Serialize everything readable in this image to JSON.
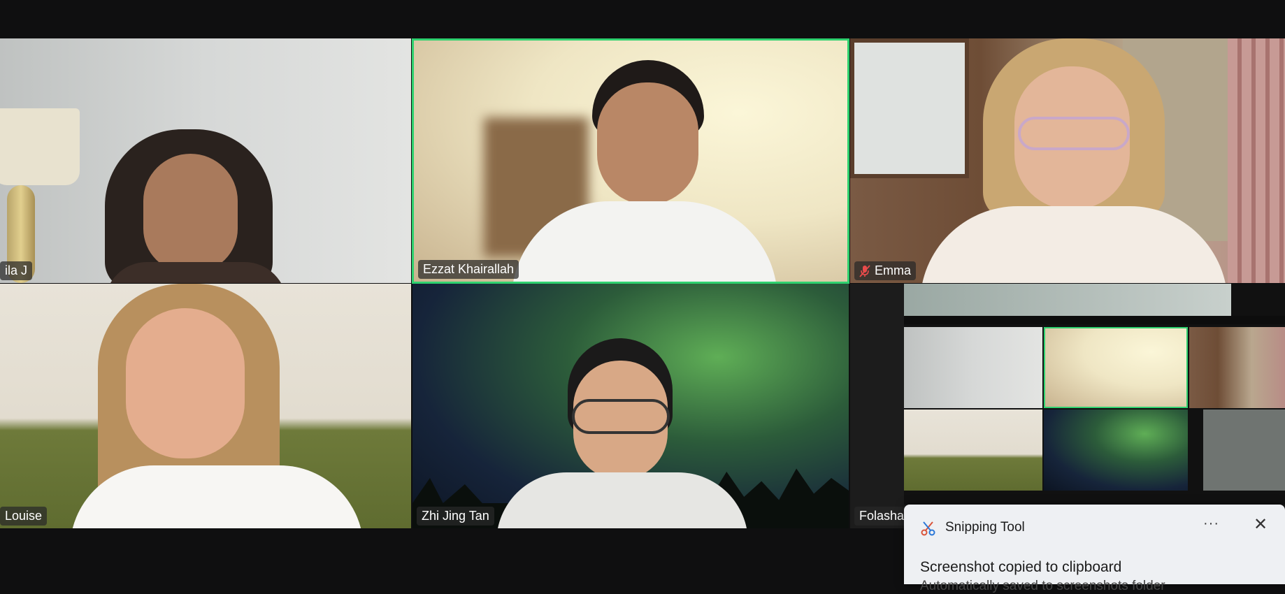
{
  "participants": [
    {
      "name": "ila J",
      "muted": false
    },
    {
      "name": "Ezzat Khairallah",
      "muted": false,
      "active": true
    },
    {
      "name": "Emma",
      "muted": true
    },
    {
      "name": "Louise",
      "muted": false
    },
    {
      "name": "Zhi Jing Tan",
      "muted": false
    },
    {
      "name": "Folashad",
      "muted": false
    }
  ],
  "colors": {
    "active_speaker_border": "#2fd16f",
    "background": "#0f0f10",
    "toast_bg": "#eef0f3"
  },
  "toast": {
    "app_name": "Snipping Tool",
    "message": "Screenshot copied to clipboard",
    "sub_message": "Automatically saved to screenshots folder",
    "more_label": "···",
    "close_label": "✕"
  }
}
